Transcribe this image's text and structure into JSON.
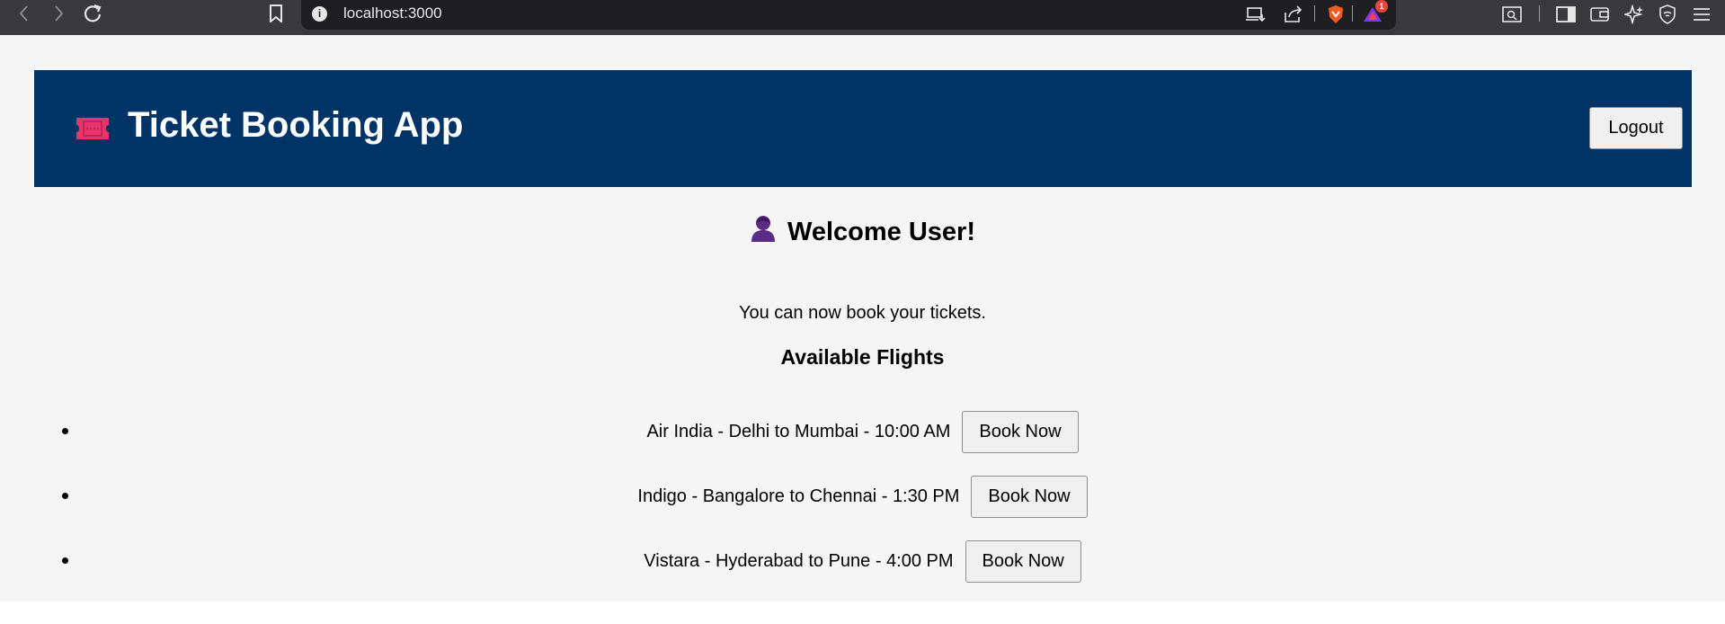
{
  "browser": {
    "url": "localhost:3000",
    "notification_count": "1"
  },
  "header": {
    "title": "Ticket Booking App",
    "logout_label": "Logout",
    "background_color": "#003366",
    "ticket_icon_color": "#e8336d"
  },
  "welcome": {
    "heading": "Welcome User!",
    "message": "You can now book your tickets.",
    "user_icon_color": "#5b2c86"
  },
  "flights": {
    "title": "Available Flights",
    "items": [
      {
        "text": "Air India - Delhi to Mumbai - 10:00 AM",
        "button": "Book Now"
      },
      {
        "text": "Indigo - Bangalore to Chennai - 1:30 PM",
        "button": "Book Now"
      },
      {
        "text": "Vistara - Hyderabad to Pune - 4:00 PM",
        "button": "Book Now"
      }
    ]
  }
}
